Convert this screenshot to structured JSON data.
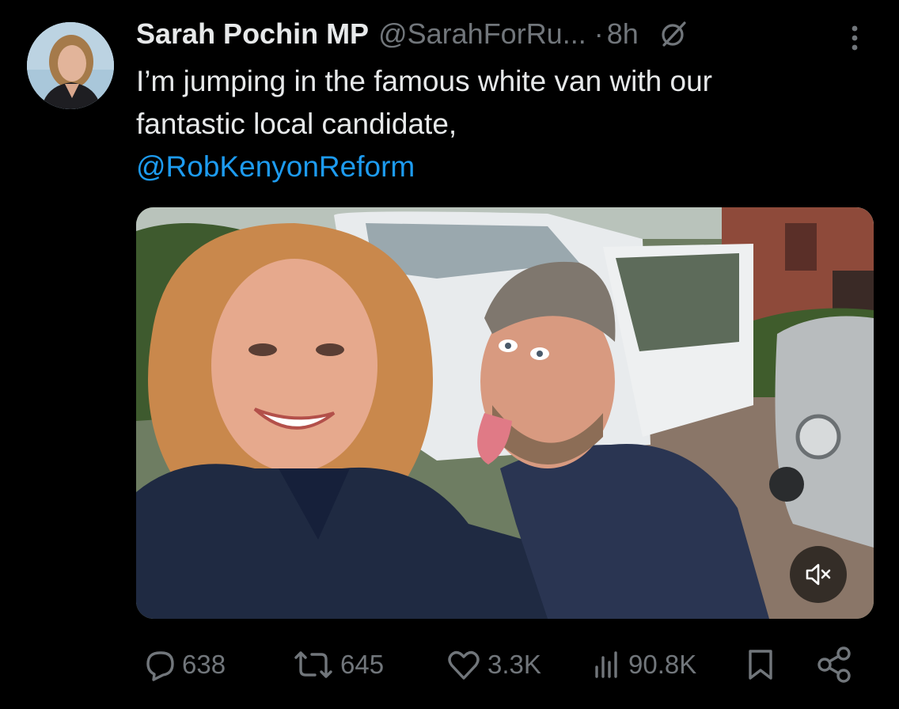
{
  "tweet": {
    "author": {
      "display_name": "Sarah Pochin MP",
      "handle": "@SarahForRu...",
      "avatar_icon": "profile-photo"
    },
    "separator": "·",
    "time": "8h",
    "grok_icon": "grok-icon",
    "more_icon": "more-vertical-icon",
    "text_lines": [
      "I’m jumping in the famous white van with our",
      "fantastic local candidate,"
    ],
    "mention": "@RobKenyonReform",
    "media": {
      "type": "video",
      "mute_icon": "speaker-muted-icon"
    },
    "actions": {
      "replies": "638",
      "reposts": "645",
      "likes": "3.3K",
      "views": "90.8K",
      "icons": [
        "reply-icon",
        "repost-icon",
        "like-icon",
        "views-icon",
        "bookmark-icon",
        "share-icon"
      ]
    }
  },
  "colors": {
    "background": "#000000",
    "primary_text": "#e7e9ea",
    "secondary_text": "#71767b",
    "link": "#1d9bf0"
  }
}
